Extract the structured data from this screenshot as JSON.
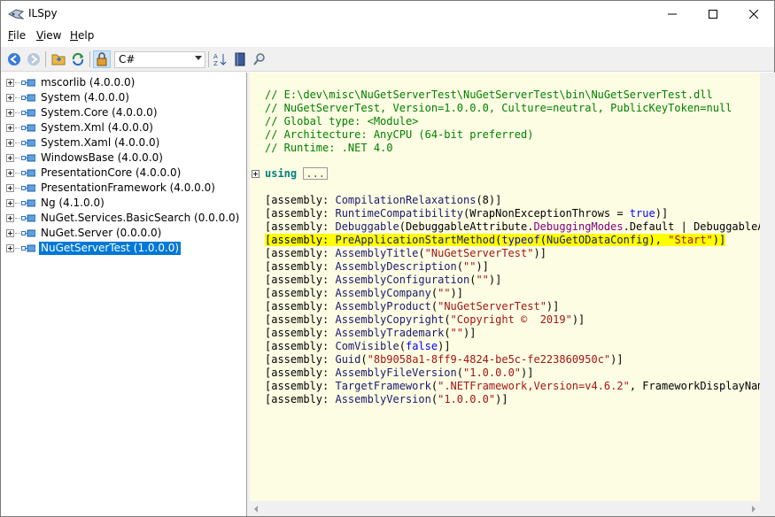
{
  "window": {
    "title": "ILSpy",
    "minimize": "—",
    "maximize": "☐",
    "close": "✕"
  },
  "menu": [
    {
      "label": "File",
      "accel": "F",
      "rest": "ile"
    },
    {
      "label": "View",
      "accel": "V",
      "rest": "iew"
    },
    {
      "label": "Help",
      "accel": "H",
      "rest": "elp"
    }
  ],
  "toolbar": {
    "icons": [
      "back-icon",
      "forward-icon",
      "open-folder-icon",
      "refresh-icon",
      "lock-icon",
      "sort-az-icon",
      "book-icon",
      "search-icon"
    ],
    "language": "C#"
  },
  "tree": {
    "items": [
      {
        "label": "mscorlib (4.0.0.0)"
      },
      {
        "label": "System (4.0.0.0)"
      },
      {
        "label": "System.Core (4.0.0.0)"
      },
      {
        "label": "System.Xml (4.0.0.0)"
      },
      {
        "label": "System.Xaml (4.0.0.0)"
      },
      {
        "label": "WindowsBase (4.0.0.0)"
      },
      {
        "label": "PresentationCore (4.0.0.0)"
      },
      {
        "label": "PresentationFramework (4.0.0.0)"
      },
      {
        "label": "Ng (4.1.0.0)"
      },
      {
        "label": "NuGet.Services.BasicSearch (0.0.0.0)"
      },
      {
        "label": "NuGet.Server (0.0.0.0)"
      },
      {
        "label": "NuGetServerTest (1.0.0.0)",
        "selected": true
      }
    ]
  },
  "code": {
    "header_comments": [
      "// E:\\dev\\misc\\NuGetServerTest\\NuGetServerTest\\bin\\NuGetServerTest.dll",
      "// NuGetServerTest, Version=1.0.0.0, Culture=neutral, PublicKeyToken=null",
      "// Global type: <Module>",
      "// Architecture: AnyCPU (64-bit preferred)",
      "// Runtime: .NET 4.0"
    ],
    "using_keyword": "using",
    "using_ellipsis": "...",
    "assembly_prefix": "[assembly: ",
    "lines": [
      {
        "attr": "CompilationRelaxations",
        "args": "(8)]"
      },
      {
        "attr": "RuntimeCompatibility",
        "args_pre": "(WrapNonExceptionThrows = ",
        "bool": "true",
        "args_post": ")]"
      },
      {
        "attr": "Debuggable",
        "args_pre": "(DebuggableAttribute.",
        "member": "DebuggingModes",
        "args_post": ".Default | DebuggableAtt"
      },
      {
        "attr": "PreApplicationStartMethod",
        "kw": "typeof",
        "args_pre": "(",
        "type": "NuGetODataConfig",
        "str": "\"Start\"",
        "args_post": ")]",
        "highlighted": true
      },
      {
        "attr": "AssemblyTitle",
        "str": "\"NuGetServerTest\""
      },
      {
        "attr": "AssemblyDescription",
        "str": "\"\""
      },
      {
        "attr": "AssemblyConfiguration",
        "str": "\"\""
      },
      {
        "attr": "AssemblyCompany",
        "str": "\"\""
      },
      {
        "attr": "AssemblyProduct",
        "str": "\"NuGetServerTest\""
      },
      {
        "attr": "AssemblyCopyright",
        "str": "\"Copyright ©  2019\""
      },
      {
        "attr": "AssemblyTrademark",
        "str": "\"\""
      },
      {
        "attr": "ComVisible",
        "bool": "false"
      },
      {
        "attr": "Guid",
        "str": "\"8b9058a1-8ff9-4824-be5c-fe223860950c\""
      },
      {
        "attr": "AssemblyFileVersion",
        "str": "\"1.0.0.0\""
      },
      {
        "attr": "TargetFramework",
        "str": "\".NETFramework,Version=v4.6.2\"",
        "args_post": ", FrameworkDisplayName"
      },
      {
        "attr": "AssemblyVersion",
        "str": "\"1.0.0.0\""
      }
    ]
  },
  "colors": {
    "comment": "#008000",
    "attribute": "#191970",
    "string": "#a31515",
    "keyword_bool": "#0000ff",
    "highlight": "#ffff00",
    "selection": "#0078d7",
    "code_background": "#fdfde3"
  }
}
